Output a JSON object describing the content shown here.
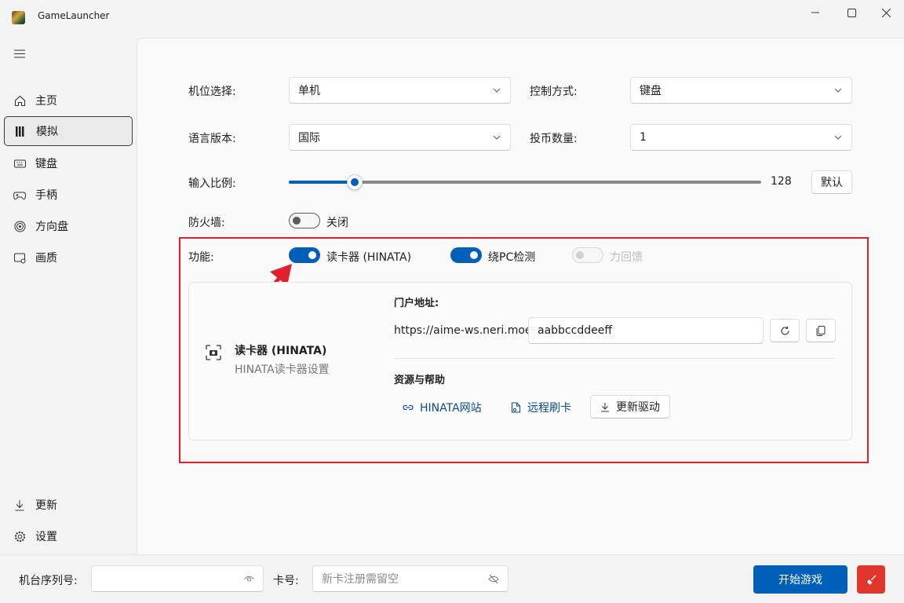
{
  "window": {
    "title": "GameLauncher"
  },
  "nav": {
    "items": [
      {
        "label": "主页",
        "icon": "home-icon"
      },
      {
        "label": "模拟",
        "icon": "emulate-icon",
        "selected": true
      },
      {
        "label": "键盘",
        "icon": "keyboard-icon"
      },
      {
        "label": "手柄",
        "icon": "gamepad-icon"
      },
      {
        "label": "方向盘",
        "icon": "steering-icon"
      },
      {
        "label": "画质",
        "icon": "display-icon"
      }
    ],
    "footer": [
      {
        "label": "更新",
        "icon": "download-icon"
      },
      {
        "label": "设置",
        "icon": "gear-icon"
      }
    ]
  },
  "settings": {
    "seat": {
      "label": "机位选择:",
      "value": "单机"
    },
    "control": {
      "label": "控制方式:",
      "value": "键盘"
    },
    "language": {
      "label": "语言版本:",
      "value": "国际"
    },
    "coins": {
      "label": "投币数量:",
      "value": "1"
    },
    "input_ratio": {
      "label": "输入比例:",
      "value": "128",
      "fraction": 0.14,
      "reset_label": "默认"
    },
    "firewall": {
      "label": "防火墙:",
      "state": "关闭"
    },
    "features": {
      "label": "功能:",
      "card_reader": "读卡器 (HINATA)",
      "bypass_pc": "绕PC检测",
      "force_feedback": "力回馈"
    }
  },
  "card_panel": {
    "title": "读卡器 (HINATA)",
    "subtitle": "HINATA读卡器设置",
    "portal_label": "门户地址:",
    "portal_prefix": "https://aime-ws.neri.moe/",
    "portal_value": "aabbccddeeff",
    "resources_label": "资源与帮助",
    "link_site": "HINATA网站",
    "link_remote": "远程刷卡",
    "update_driver": "更新驱动"
  },
  "bottom": {
    "serial_label": "机台序列号:",
    "serial_value": "",
    "card_label": "卡号:",
    "card_placeholder": "新卡注册需留空",
    "start_label": "开始游戏"
  },
  "colors": {
    "accent": "#005fb8",
    "danger": "#e0362c",
    "annotation": "#e0202a"
  }
}
